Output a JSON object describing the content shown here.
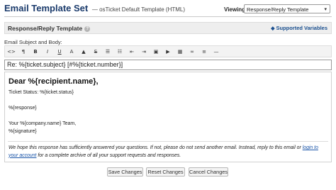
{
  "header": {
    "title": "Email Template Set",
    "subtitle": "— osTicket Default Template (HTML)",
    "viewing_label": "Viewing:",
    "viewing_value": "Response/Reply Template"
  },
  "section": {
    "title": "Response/Reply Template",
    "vars_link": "Supported Variables"
  },
  "field_label": "Email Subject and Body:",
  "toolbar": {
    "buttons": [
      {
        "name": "code-view-icon",
        "glyph": "<>"
      },
      {
        "name": "paragraph-icon",
        "glyph": "¶"
      },
      {
        "name": "bold-icon",
        "glyph": "B"
      },
      {
        "name": "italic-icon",
        "glyph": "I"
      },
      {
        "name": "underline-icon",
        "glyph": "U"
      },
      {
        "name": "text-color-icon",
        "glyph": "A"
      },
      {
        "name": "highlight-icon",
        "glyph": "▲"
      },
      {
        "name": "strikethrough-icon",
        "glyph": "S"
      },
      {
        "name": "unordered-list-icon",
        "glyph": "☰"
      },
      {
        "name": "ordered-list-icon",
        "glyph": "☷"
      },
      {
        "name": "outdent-icon",
        "glyph": "⇤"
      },
      {
        "name": "indent-icon",
        "glyph": "⇥"
      },
      {
        "name": "image-icon",
        "glyph": "▣"
      },
      {
        "name": "video-icon",
        "glyph": "▶"
      },
      {
        "name": "table-icon",
        "glyph": "▦"
      },
      {
        "name": "link-icon",
        "glyph": "∞"
      },
      {
        "name": "align-icon",
        "glyph": "≡"
      },
      {
        "name": "horizontal-rule-icon",
        "glyph": "—"
      }
    ]
  },
  "subject": {
    "value": "Re: %{ticket.subject} [#%{ticket.number}]"
  },
  "body": {
    "greeting": "Dear %{recipient.name},",
    "status_line": "Ticket Status: %{ticket.status}",
    "response": "%{response}",
    "signoff": "Your %{company.name} Team,",
    "signature": "%{signature}",
    "footer_pre": "We hope this response has sufficiently answered your questions. If not, please do not send another email. Instead, reply to this email or ",
    "footer_link": "login to your account",
    "footer_post": " for a complete archive of all your support requests and responses."
  },
  "actions": {
    "save": "Save Changes",
    "reset": "Reset Changes",
    "cancel": "Cancel Changes"
  },
  "colors": {
    "title": "#1a3a6b",
    "link": "#1a55a8"
  }
}
